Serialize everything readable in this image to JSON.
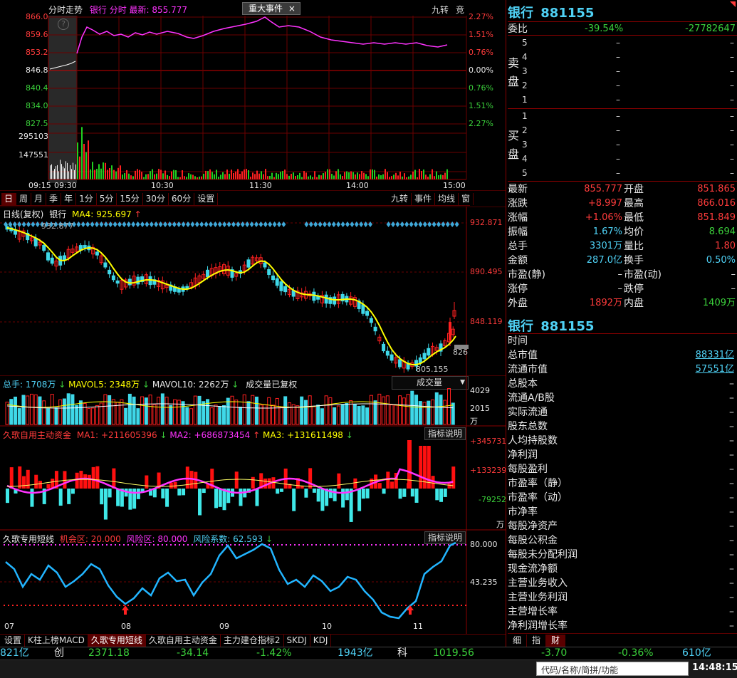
{
  "intraday": {
    "tab_label": "分时走势",
    "name": "银行",
    "mode": "分时",
    "latest_label": "最新:",
    "latest_value": "855.777",
    "event_tab": "重大事件",
    "close_icon": "×",
    "jiuzhuan": "九转",
    "jing": "竞",
    "help_icon": "?",
    "price_labels": [
      "866.0",
      "859.6",
      "853.2",
      "846.8",
      "840.4",
      "834.0",
      "827.5"
    ],
    "pct_labels": [
      "2.27%",
      "1.51%",
      "0.76%",
      "0.00%",
      "0.76%",
      "1.51%",
      "2.27%"
    ],
    "vol_labels": [
      "295103",
      "147551"
    ],
    "time_labels": [
      "09:15",
      "09:30",
      "10:30",
      "11:30",
      "14:00",
      "15:00"
    ]
  },
  "kline_toolbar": {
    "tabs": [
      "日",
      "周",
      "月",
      "季",
      "年",
      "1分",
      "5分",
      "15分",
      "30分",
      "60分",
      "设置"
    ],
    "right_tabs": [
      "九转",
      "事件",
      "均线",
      "窗"
    ]
  },
  "kline": {
    "title": "日线(复权)",
    "name": "银行",
    "ma_label": "MA4:",
    "ma_value": "925.697",
    "ma_arrow": "↑",
    "high_mark": "932.877",
    "low_mark": "805.155",
    "right_mark": "826",
    "axis_labels": [
      "932.871",
      "890.495",
      "848.119"
    ]
  },
  "volume": {
    "label": "总手:",
    "value": "1708万",
    "arrow": "↓",
    "mavol5_label": "MAVOL5:",
    "mavol5_value": "2348万",
    "mavol10_label": "MAVOL10:",
    "mavol10_value": "2262万",
    "note": "成交量已复权",
    "dropdown": "成交量",
    "axis_labels": [
      "4029",
      "2015",
      "万"
    ]
  },
  "fund": {
    "title": "久歌自用主动资金",
    "ma1_label": "MA1:",
    "ma1_value": "+211605396",
    "ma2_label": "MA2:",
    "ma2_value": "+686873454",
    "ma3_label": "MA3:",
    "ma3_value": "+131611498",
    "help_button": "指标说明",
    "axis_labels": [
      "+345731",
      "+133239",
      "-79252",
      "万"
    ]
  },
  "short": {
    "title": "久歌专用短线",
    "opp_label": "机会区:",
    "opp_value": "20.000",
    "risk_label": "风险区:",
    "risk_value": "80.000",
    "coef_label": "风险系数:",
    "coef_value": "62.593",
    "help_button": "指标说明",
    "axis_labels": [
      "80.000",
      "43.235"
    ]
  },
  "date_labels": [
    "07",
    "08",
    "09",
    "10",
    "11"
  ],
  "bottom_tabs": [
    "设置",
    "K柱上榜MACD",
    "久歌专用短线",
    "久歌自用主动资金",
    "主力建仓指标2",
    "SKDJ",
    "KDJ"
  ],
  "ticker": {
    "items": [
      {
        "text": "821亿",
        "color": "cyan"
      },
      {
        "text": "创",
        "color": "white"
      },
      {
        "text": "2371.18",
        "color": "green"
      },
      {
        "text": "-34.14",
        "color": "green"
      },
      {
        "text": "-1.42%",
        "color": "green"
      },
      {
        "text": "1943亿",
        "color": "cyan"
      },
      {
        "text": "科",
        "color": "white"
      },
      {
        "text": "1019.56",
        "color": "green"
      },
      {
        "text": "-3.70",
        "color": "green"
      },
      {
        "text": "-0.36%",
        "color": "green"
      },
      {
        "text": "610亿",
        "color": "cyan"
      }
    ]
  },
  "status_bar": {
    "search_placeholder": "代码/名称/简拼/功能",
    "time": "14:48:15"
  },
  "right_panel": {
    "title": "银行",
    "code": "881155",
    "weibi_label": "委比",
    "weibi_pct": "-39.54%",
    "weibi_diff": "-27782647",
    "sell_label": "卖盘",
    "buy_label": "买盘",
    "sell_levels": [
      "5",
      "4",
      "3",
      "2",
      "1"
    ],
    "buy_levels": [
      "1",
      "2",
      "3",
      "4",
      "5"
    ],
    "dash": "–",
    "stats": [
      {
        "l1": "最新",
        "v1": "855.777",
        "c1": "red",
        "l2": "开盘",
        "v2": "851.865",
        "c2": "red"
      },
      {
        "l1": "涨跌",
        "v1": "+8.997",
        "c1": "red",
        "l2": "最高",
        "v2": "866.016",
        "c2": "red"
      },
      {
        "l1": "涨幅",
        "v1": "+1.06%",
        "c1": "red",
        "l2": "最低",
        "v2": "851.849",
        "c2": "red"
      },
      {
        "l1": "振幅",
        "v1": "1.67%",
        "c1": "cyan",
        "l2": "均价",
        "v2": "8.694",
        "c2": "green"
      },
      {
        "l1": "总手",
        "v1": "3301万",
        "c1": "cyan",
        "l2": "量比",
        "v2": "1.80",
        "c2": "red"
      },
      {
        "l1": "金额",
        "v1": "287.0亿",
        "c1": "cyan",
        "l2": "换手",
        "v2": "0.50%",
        "c2": "cyan"
      },
      {
        "l1": "市盈(静)",
        "v1": "–",
        "c1": "white",
        "l2": "市盈(动)",
        "v2": "–",
        "c2": "white"
      },
      {
        "l1": "涨停",
        "v1": "–",
        "c1": "white",
        "l2": "跌停",
        "v2": "–",
        "c2": "white"
      },
      {
        "l1": "外盘",
        "v1": "1892万",
        "c1": "red",
        "l2": "内盘",
        "v2": "1409万",
        "c2": "green"
      }
    ],
    "title2": "银行",
    "code2": "881155",
    "fundamentals": [
      {
        "label": "时间",
        "value": ""
      },
      {
        "label": "总市值",
        "value": "88331亿"
      },
      {
        "label": "流通市值",
        "value": "57551亿"
      },
      {
        "label": "总股本",
        "value": "–"
      },
      {
        "label": "流通A/B股",
        "value": "–"
      },
      {
        "label": "实际流通",
        "value": "–"
      },
      {
        "label": "股东总数",
        "value": "–"
      },
      {
        "label": "人均持股数",
        "value": "–"
      },
      {
        "label": "净利润",
        "value": "–"
      },
      {
        "label": "每股盈利",
        "value": "–"
      },
      {
        "label": "市盈率（静）",
        "value": "–"
      },
      {
        "label": "市盈率（动）",
        "value": "–"
      },
      {
        "label": "市净率",
        "value": "–"
      },
      {
        "label": "每股净资产",
        "value": "–"
      },
      {
        "label": "每股公积金",
        "value": "–"
      },
      {
        "label": "每股未分配利润",
        "value": "–"
      },
      {
        "label": "现金流净额",
        "value": "–"
      },
      {
        "label": "主营业务收入",
        "value": "–"
      },
      {
        "label": "主营业务利润",
        "value": "–"
      },
      {
        "label": "主营增长率",
        "value": "–"
      },
      {
        "label": "净利润增长率",
        "value": "–"
      }
    ],
    "bottom_tabs": [
      "细",
      "指",
      "财"
    ]
  }
}
